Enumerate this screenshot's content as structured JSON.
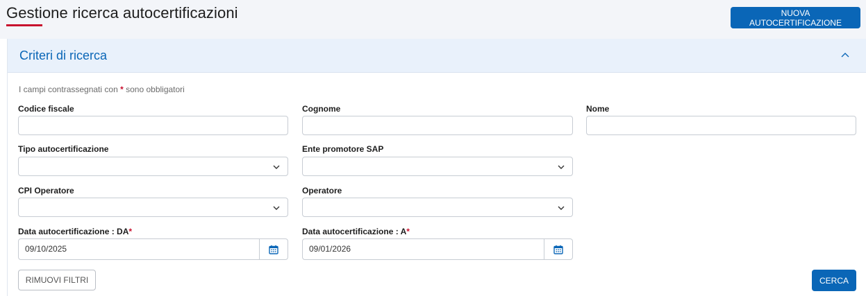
{
  "header": {
    "title": "Gestione ricerca autocertificazioni",
    "new_button_label": "NUOVA AUTOCERTIFICAZIONE"
  },
  "panel": {
    "title": "Criteri di ricerca",
    "toggle_icon": "chevron-up-icon"
  },
  "form": {
    "hint_before": "I campi contrassegnati con",
    "hint_star": "*",
    "hint_after": "sono obbligatori",
    "fields": {
      "codice_fiscale": {
        "label": "Codice fiscale",
        "value": ""
      },
      "cognome": {
        "label": "Cognome",
        "value": ""
      },
      "nome": {
        "label": "Nome",
        "value": ""
      },
      "tipo_autocertificazione": {
        "label": "Tipo autocertificazione",
        "value": ""
      },
      "ente_promotore": {
        "label": "Ente promotore SAP",
        "value": ""
      },
      "cpi_operatore": {
        "label": "CPI Operatore",
        "value": ""
      },
      "operatore": {
        "label": "Operatore",
        "value": ""
      },
      "data_da": {
        "label": "Data autocertificazione : DA",
        "required_mark": "*",
        "value": "09/10/2025"
      },
      "data_a": {
        "label": "Data autocertificazione : A",
        "required_mark": "*",
        "value": "09/01/2026"
      }
    },
    "reset_label": "RIMUOVI FILTRI",
    "search_label": "CERCA"
  },
  "colors": {
    "accent": "#0a66b7",
    "required": "#c8102e",
    "panel_header_bg": "#e9f1fb"
  }
}
